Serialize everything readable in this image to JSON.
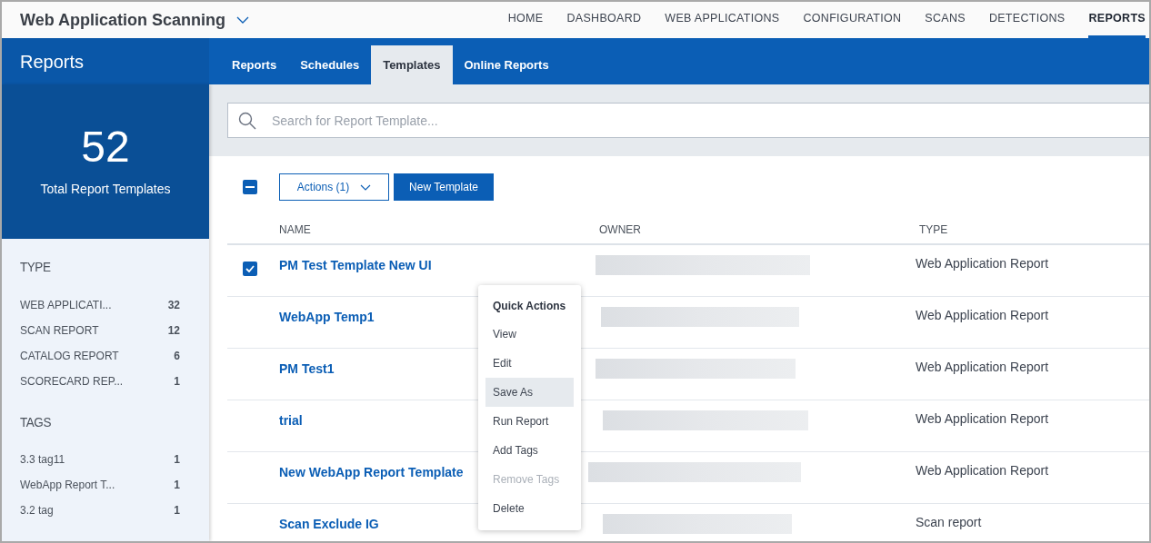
{
  "app": {
    "title": "Web Application Scanning"
  },
  "top_nav": [
    {
      "label": "HOME",
      "selected": false
    },
    {
      "label": "DASHBOARD",
      "selected": false
    },
    {
      "label": "WEB APPLICATIONS",
      "selected": false
    },
    {
      "label": "CONFIGURATION",
      "selected": false
    },
    {
      "label": "SCANS",
      "selected": false
    },
    {
      "label": "DETECTIONS",
      "selected": false
    },
    {
      "label": "REPORTS",
      "selected": true
    }
  ],
  "section_title": "Reports",
  "tabs": [
    {
      "label": "Reports",
      "selected": false
    },
    {
      "label": "Schedules",
      "selected": false
    },
    {
      "label": "Templates",
      "selected": true
    },
    {
      "label": "Online Reports",
      "selected": false
    }
  ],
  "summary": {
    "count": "52",
    "label": "Total Report Templates"
  },
  "facets": [
    {
      "title": "TYPE",
      "items": [
        {
          "label": "WEB APPLICATI...",
          "count": "32"
        },
        {
          "label": "SCAN REPORT",
          "count": "12"
        },
        {
          "label": "CATALOG REPORT",
          "count": "6"
        },
        {
          "label": "SCORECARD REP...",
          "count": "1"
        }
      ]
    },
    {
      "title": "TAGS",
      "items": [
        {
          "label": "3.3 tag11",
          "count": "1"
        },
        {
          "label": "WebApp Report T...",
          "count": "1"
        },
        {
          "label": "3.2 tag",
          "count": "1"
        }
      ]
    }
  ],
  "search": {
    "placeholder": "Search for Report Template..."
  },
  "toolbar": {
    "select_all_indeterminate": true,
    "actions_button": "Actions (1)",
    "new_button": "New Template"
  },
  "table": {
    "columns": [
      "NAME",
      "OWNER",
      "TYPE"
    ],
    "rows": [
      {
        "name": "PM Test Template New UI",
        "type": "Web Application Report",
        "checked": true
      },
      {
        "name": "WebApp Temp1",
        "type": "Web Application Report",
        "checked": false
      },
      {
        "name": "PM Test1",
        "type": "Web Application Report",
        "checked": false
      },
      {
        "name": "trial",
        "type": "Web Application Report",
        "checked": false
      },
      {
        "name": "New WebApp Report Template",
        "type": "Web Application Report",
        "checked": false
      },
      {
        "name": "Scan Exclude IG",
        "type": "Scan report",
        "checked": false
      }
    ]
  },
  "quick_actions": {
    "title": "Quick Actions",
    "items": [
      {
        "label": "View",
        "selected": false,
        "disabled": false
      },
      {
        "label": "Edit",
        "selected": false,
        "disabled": false
      },
      {
        "label": "Save As",
        "selected": true,
        "disabled": false
      },
      {
        "label": "Run Report",
        "selected": false,
        "disabled": false
      },
      {
        "label": "Add Tags",
        "selected": false,
        "disabled": false
      },
      {
        "label": "Remove Tags",
        "selected": false,
        "disabled": true
      },
      {
        "label": "Delete",
        "selected": false,
        "disabled": false
      }
    ]
  }
}
